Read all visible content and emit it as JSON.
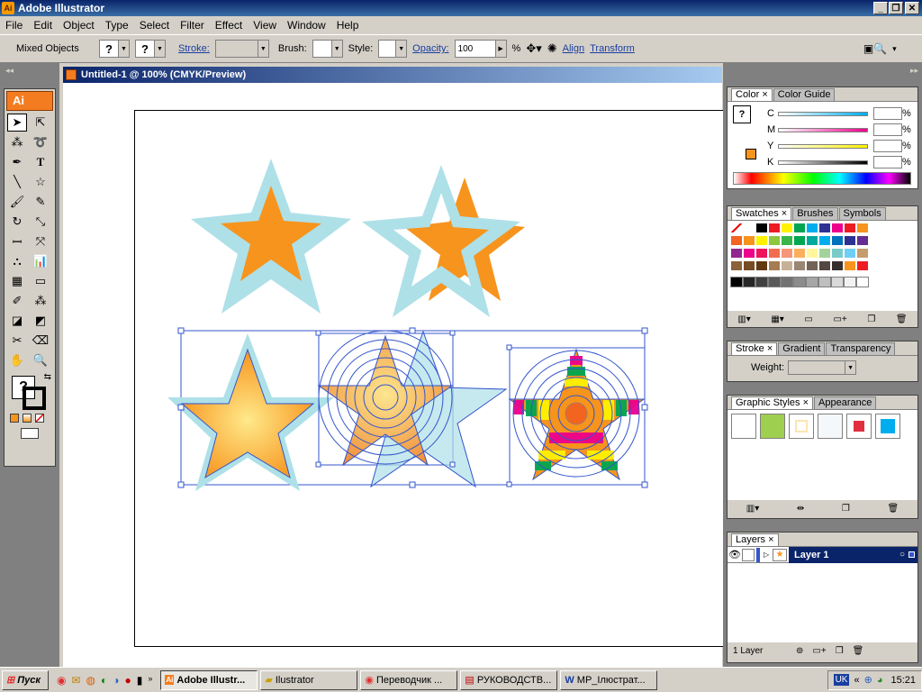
{
  "window": {
    "title": "Adobe Illustrator",
    "app_icon": "Ai"
  },
  "menus": [
    "File",
    "Edit",
    "Object",
    "Type",
    "Select",
    "Filter",
    "Effect",
    "View",
    "Window",
    "Help"
  ],
  "control": {
    "object_type": "Mixed Objects",
    "fill_value": "?",
    "stroke_color_value": "?",
    "stroke_label": "Stroke:",
    "brush_label": "Brush:",
    "style_label": "Style:",
    "opacity_label": "Opacity:",
    "opacity_value": "100",
    "opacity_unit": "%",
    "align_label": "Align",
    "transform_label": "Transform"
  },
  "toolbox": {
    "logo": "Ai",
    "fill_stroke_value": "?"
  },
  "document": {
    "title": "Untitled-1 @ 100% (CMYK/Preview)"
  },
  "color_panel": {
    "tabs": [
      "Color",
      "Color Guide"
    ],
    "channels": [
      "C",
      "M",
      "Y",
      "K"
    ],
    "unit": "%"
  },
  "swatches_panel": {
    "tabs": [
      "Swatches",
      "Brushes",
      "Symbols"
    ],
    "rows": [
      [
        "#ffffff",
        "#ffffff",
        "#000000",
        "#ed1c24",
        "#fff200",
        "#00a651",
        "#00aeef",
        "#2e3192",
        "#ec008c",
        "#ed1c24",
        "#f7941d"
      ],
      [
        "#f26522",
        "#f7941d",
        "#fff200",
        "#8dc63f",
        "#39b54a",
        "#00a651",
        "#00a99d",
        "#00aeef",
        "#0072bc",
        "#2e3192",
        "#662d91"
      ],
      [
        "#92278f",
        "#ec008c",
        "#ed145b",
        "#f26c4f",
        "#f69679",
        "#fbaf5d",
        "#fff799",
        "#a3d39c",
        "#7accc8",
        "#6dcff6",
        "#c69c6d"
      ],
      [
        "#8c6239",
        "#754c24",
        "#603913",
        "#a67c52",
        "#c7b299",
        "#998675",
        "#736357",
        "#534741",
        "#362f2d",
        "#f7941d",
        "#ed1c24"
      ]
    ],
    "grays": [
      "#000000",
      "#262626",
      "#404040",
      "#595959",
      "#737373",
      "#8c8c8c",
      "#a6a6a6",
      "#bfbfbf",
      "#d9d9d9",
      "#f2f2f2",
      "#ffffff"
    ]
  },
  "stroke_panel": {
    "tabs": [
      "Stroke",
      "Gradient",
      "Transparency"
    ],
    "weight_label": "Weight:"
  },
  "graphic_styles_panel": {
    "tabs": [
      "Graphic Styles",
      "Appearance"
    ]
  },
  "layers_panel": {
    "tabs": [
      "Layers"
    ],
    "layer_name": "Layer 1",
    "count": "1 Layer"
  },
  "taskbar": {
    "start": "Пуск",
    "items": [
      "Adobe Illustr...",
      "Ilustrator",
      "Переводчик ...",
      "РУКОВОДСТВ...",
      "MP_Ілюстрат..."
    ],
    "lang": "UK",
    "clock": "15:21"
  },
  "colors": {
    "orange": "#f7941d",
    "light_blue": "#aee0e8",
    "selection": "#3355cc"
  }
}
